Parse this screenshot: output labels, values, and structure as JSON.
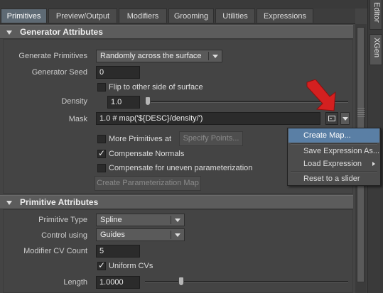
{
  "tabs": [
    "Primitives",
    "Preview/Output",
    "Modifiers",
    "Grooming",
    "Utilities",
    "Expressions"
  ],
  "side_tabs": [
    "Editor",
    "XGen"
  ],
  "generator": {
    "section_title": "Generator Attributes",
    "generate_primitives_label": "Generate Primitives",
    "generate_primitives_value": "Randomly across the surface",
    "generator_seed_label": "Generator Seed",
    "generator_seed_value": "0",
    "flip_label": "Flip to other side of surface",
    "flip_checked": false,
    "density_label": "Density",
    "density_value": "1.0",
    "density_slider_fraction": 0.0,
    "mask_label": "Mask",
    "mask_value": "1.0 # map('${DESC}/density/')",
    "more_primitives_label": "More Primitives at",
    "more_primitives_checked": false,
    "specify_points_label": "Specify Points...",
    "compensate_normals_label": "Compensate Normals",
    "compensate_normals_checked": true,
    "compensate_uneven_label": "Compensate for uneven parameterization",
    "compensate_uneven_checked": false,
    "create_param_map_label": "Create Parameterization Map"
  },
  "context_menu": {
    "items": [
      "Create Map...",
      "Save Expression As...",
      "Load Expression",
      "Reset to a slider"
    ],
    "highlighted": "Create Map..."
  },
  "primitive": {
    "section_title": "Primitive Attributes",
    "primitive_type_label": "Primitive Type",
    "primitive_type_value": "Spline",
    "control_using_label": "Control using",
    "control_using_value": "Guides",
    "modifier_cv_count_label": "Modifier CV Count",
    "modifier_cv_count_value": "5",
    "uniform_cvs_label": "Uniform CVs",
    "uniform_cvs_checked": true,
    "length_label": "Length",
    "length_value": "1.0000",
    "length_slider_fraction": 0.17
  },
  "colors": {
    "accent_highlight": "#5a7fa5",
    "annotation_arrow": "#d42020"
  }
}
